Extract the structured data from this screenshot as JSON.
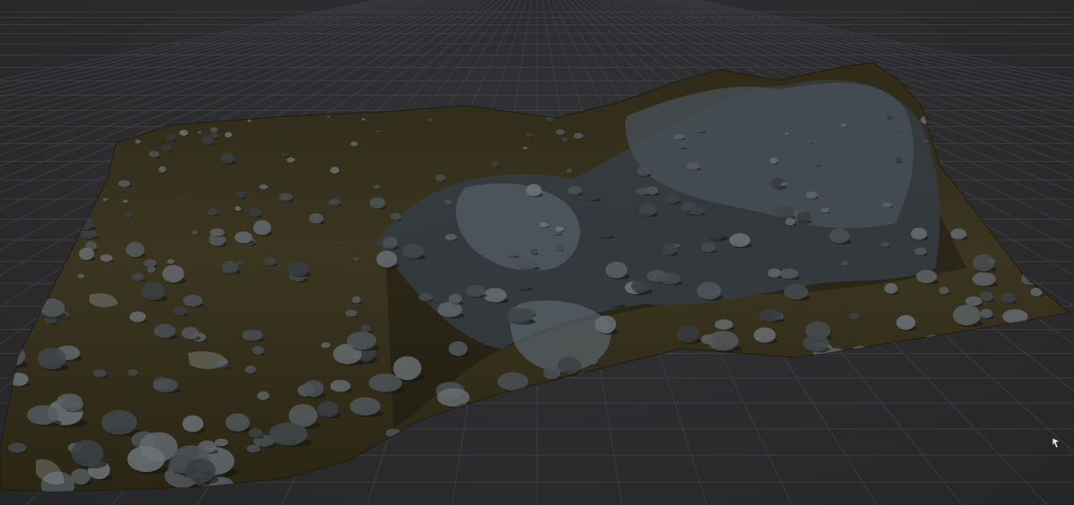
{
  "viewport": {
    "background": "#2b2b2e",
    "grid_color": "#4a4a50",
    "terrain_ground_color": "#3a351e",
    "terrain_rock_color": "#4b5258"
  },
  "scene": {
    "icons": {
      "cursor": "cursor-icon"
    }
  }
}
